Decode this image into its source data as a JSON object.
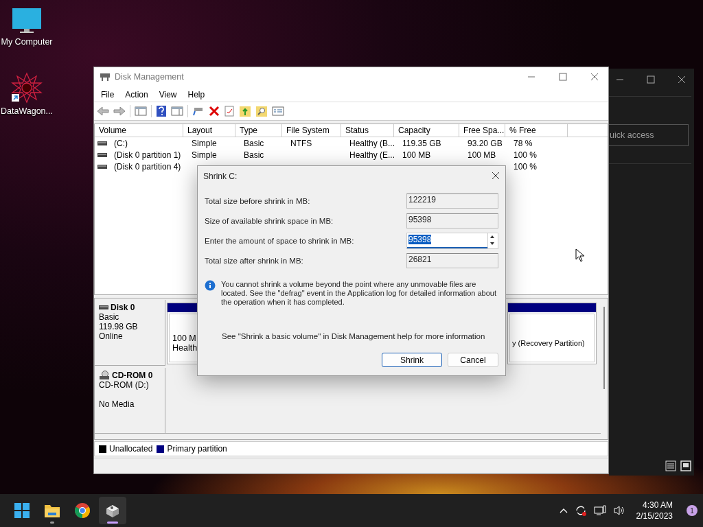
{
  "desktop_icons": [
    {
      "label": "My Computer",
      "kind": "computer"
    },
    {
      "label": "DataWagon...",
      "kind": "shortcut"
    }
  ],
  "background_window": {
    "search": {
      "placeholder": "uick access"
    }
  },
  "window": {
    "title": "Disk Management",
    "menu": [
      "File",
      "Action",
      "View",
      "Help"
    ],
    "table": {
      "columns": [
        "Volume",
        "Layout",
        "Type",
        "File System",
        "Status",
        "Capacity",
        "Free Spa...",
        "% Free"
      ],
      "rows": [
        {
          "volume": "(C:)",
          "layout": "Simple",
          "type": "Basic",
          "file_system": "NTFS",
          "status": "Healthy (B...",
          "capacity": "119.35 GB",
          "free_space": "93.20 GB",
          "percent_free": "78 %"
        },
        {
          "volume": "(Disk 0 partition 1)",
          "layout": "Simple",
          "type": "Basic",
          "status": "Healthy (E...",
          "capacity": "100 MB",
          "free_space": "100 MB",
          "percent_free": "100 %"
        },
        {
          "volume": "(Disk 0 partition 4)",
          "percent_free": "100 %"
        }
      ]
    },
    "disks": [
      {
        "kind": "disk",
        "name": "Disk 0",
        "type": "Basic",
        "size": "119.98 GB",
        "status": "Online",
        "partitions": [
          {
            "lines": [
              "100 M",
              "Health"
            ]
          },
          {
            "lines": [
              "y (Recovery Partition)"
            ]
          }
        ]
      },
      {
        "kind": "cdrom",
        "name": "CD-ROM 0",
        "type": "CD-ROM (D:)",
        "status": "No Media"
      }
    ],
    "legend": [
      {
        "label": "Unallocated",
        "color": "#000000"
      },
      {
        "label": "Primary partition",
        "color": "#000080"
      }
    ]
  },
  "dialog": {
    "title": "Shrink C:",
    "fields": [
      {
        "label": "Total size before shrink in MB:",
        "value": "122219",
        "kind": "readonly",
        "highlighted": false
      },
      {
        "label": "Size of available shrink space in MB:",
        "value": "95398",
        "kind": "readonly",
        "highlighted": false
      },
      {
        "label": "Enter the amount of space to shrink in MB:",
        "value": "95398",
        "kind": "spinner",
        "highlighted": true
      },
      {
        "label": "Total size after shrink in MB:",
        "value": "26821",
        "kind": "readonly",
        "highlighted": false
      }
    ],
    "note": "You cannot shrink a volume beyond the point where any unmovable files are located. See the \"defrag\" event in the Application log for detailed information about the operation when it has completed.",
    "help": "See \"Shrink a basic volume\" in Disk Management help for more information",
    "buttons": [
      {
        "label": "Shrink",
        "default": true
      },
      {
        "label": "Cancel",
        "default": false
      }
    ]
  },
  "taskbar": {
    "apps": [
      {
        "kind": "start",
        "running": false,
        "active": false
      },
      {
        "kind": "explorer",
        "running": true,
        "active": false
      },
      {
        "kind": "chrome",
        "running": false,
        "active": false
      },
      {
        "kind": "disk",
        "running": true,
        "active": true
      }
    ],
    "time": "4:30 AM",
    "date": "2/15/2023",
    "badge": "1"
  }
}
